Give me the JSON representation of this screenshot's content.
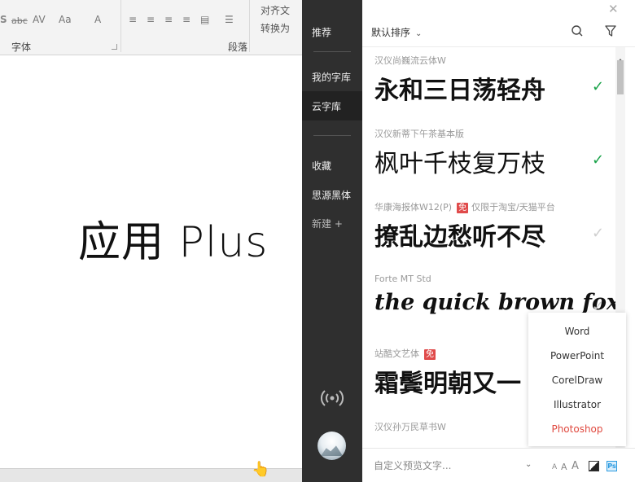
{
  "ribbon": {
    "font_group_label": "字体",
    "paragraph_group_label": "段落",
    "align_text_label": "对齐文",
    "convert_label": "转换为",
    "abc_label": "abc",
    "av_label": "AV",
    "aa_label": "Aa",
    "a_label": "A"
  },
  "document": {
    "body_text": "应用 Plus"
  },
  "sidebar": {
    "items": [
      {
        "label": "推荐"
      },
      {
        "label": "我的字库"
      },
      {
        "label": "云字库"
      },
      {
        "label": "收藏"
      },
      {
        "label": "思源黑体"
      },
      {
        "label": "新建 +"
      }
    ]
  },
  "header": {
    "sort_label": "默认排序"
  },
  "fonts": [
    {
      "name": "汉仪尚巍流云体W",
      "sample": "永和三日荡轻舟",
      "note": "",
      "free": false,
      "selected": true
    },
    {
      "name": "汉仪新蒂下午茶基本版",
      "sample": "枫叶千枝复万枝",
      "note": "",
      "free": false,
      "selected": true
    },
    {
      "name": "华康海报体W12(P)",
      "sample": "撩乱边愁听不尽",
      "note": "仅限于淘宝/天猫平台",
      "free": true,
      "free_label": "免",
      "selected": false
    },
    {
      "name": "Forte MT Std",
      "sample": "the quick brown fox",
      "note": "",
      "free": false,
      "selected": false
    },
    {
      "name": "站酷文艺体",
      "sample": "霜鬓明朝又一",
      "note": "",
      "free": true,
      "free_label": "免",
      "selected": false
    },
    {
      "name": "汉仪孙万民草书W",
      "sample": "",
      "note": "",
      "free": false,
      "selected": false
    }
  ],
  "app_menu": {
    "items": [
      "Word",
      "PowerPoint",
      "CorelDraw",
      "Illustrator",
      "Photoshop"
    ],
    "active": "Photoshop"
  },
  "bottom_bar": {
    "preview_placeholder": "自定义预览文字...",
    "size_small": "A",
    "size_medium": "A",
    "size_large": "A",
    "ps_label": "Ps"
  },
  "colors": {
    "sidebar_bg": "#2f2f2f",
    "selected_check": "#1aa34a",
    "free_badge": "#e04b4b",
    "active_app": "#e0493f"
  }
}
